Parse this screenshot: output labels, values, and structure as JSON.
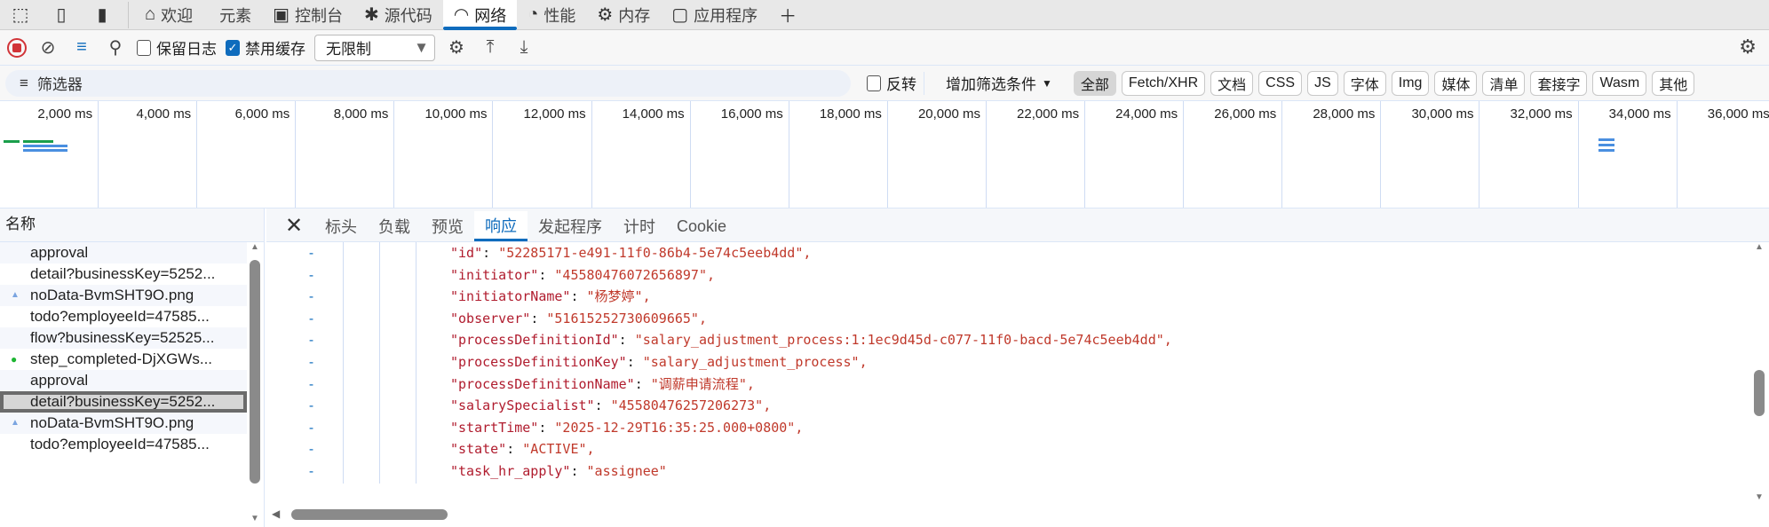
{
  "tabs": [
    {
      "label": "欢迎",
      "icon": "home-icon"
    },
    {
      "label": "元素",
      "icon": "code-icon"
    },
    {
      "label": "控制台",
      "icon": "console-icon"
    },
    {
      "label": "源代码",
      "icon": "bug-icon"
    },
    {
      "label": "网络",
      "icon": "wifi-icon",
      "active": true
    },
    {
      "label": "性能",
      "icon": "gauge-icon"
    },
    {
      "label": "内存",
      "icon": "chip-icon"
    },
    {
      "label": "应用程序",
      "icon": "app-icon"
    }
  ],
  "toolbar": {
    "preserve_log": "保留日志",
    "preserve_log_checked": false,
    "disable_cache": "禁用缓存",
    "disable_cache_checked": true,
    "throttle": "无限制"
  },
  "filter": {
    "placeholder": "筛选器",
    "invert": "反转",
    "more_filters": "增加筛选条件",
    "types": [
      "全部",
      "Fetch/XHR",
      "文档",
      "CSS",
      "JS",
      "字体",
      "Img",
      "媒体",
      "清单",
      "套接字",
      "Wasm",
      "其他"
    ],
    "active_type": "全部"
  },
  "timeline": {
    "ticks": [
      "2,000 ms",
      "4,000 ms",
      "6,000 ms",
      "8,000 ms",
      "10,000 ms",
      "12,000 ms",
      "14,000 ms",
      "16,000 ms",
      "18,000 ms",
      "20,000 ms",
      "22,000 ms",
      "24,000 ms",
      "26,000 ms",
      "28,000 ms",
      "30,000 ms",
      "32,000 ms",
      "34,000 ms",
      "36,000 ms"
    ]
  },
  "requests": {
    "header": "名称",
    "items": [
      {
        "name": "approval"
      },
      {
        "name": "detail?businessKey=5252..."
      },
      {
        "name": "noData-BvmSHT9O.png",
        "icon": "image-icon"
      },
      {
        "name": "todo?employeeId=47585..."
      },
      {
        "name": "flow?businessKey=52525..."
      },
      {
        "name": "step_completed-DjXGWs...",
        "icon": "check-icon"
      },
      {
        "name": "approval"
      },
      {
        "name": "detail?businessKey=5252...",
        "selected": true
      },
      {
        "name": "noData-BvmSHT9O.png",
        "icon": "image-icon"
      },
      {
        "name": "todo?employeeId=47585..."
      }
    ]
  },
  "detail": {
    "tabs": [
      "标头",
      "负载",
      "预览",
      "响应",
      "发起程序",
      "计时",
      "Cookie"
    ],
    "active": "响应",
    "lines": [
      {
        "key": "\"id\"",
        "value": "\"52285171-e491-11f0-86b4-5e74c5eeb4dd\","
      },
      {
        "key": "\"initiator\"",
        "value": "\"45580476072656897\","
      },
      {
        "key": "\"initiatorName\"",
        "value": "\"杨梦婷\","
      },
      {
        "key": "\"observer\"",
        "value": "\"51615252730609665\","
      },
      {
        "key": "\"processDefinitionId\"",
        "value": "\"salary_adjustment_process:1:1ec9d45d-c077-11f0-bacd-5e74c5eeb4dd\","
      },
      {
        "key": "\"processDefinitionKey\"",
        "value": "\"salary_adjustment_process\","
      },
      {
        "key": "\"processDefinitionName\"",
        "value": "\"调薪申请流程\","
      },
      {
        "key": "\"salarySpecialist\"",
        "value": "\"45580476257206273\","
      },
      {
        "key": "\"startTime\"",
        "value": "\"2025-12-29T16:35:25.000+0800\","
      },
      {
        "key": "\"state\"",
        "value": "\"ACTIVE\","
      },
      {
        "key": "\"task_hr_apply\"",
        "value": "\"assignee\""
      }
    ]
  },
  "colors": {
    "accent": "#0f6cbd",
    "record": "#d13438",
    "json_string": "#c0392b"
  }
}
